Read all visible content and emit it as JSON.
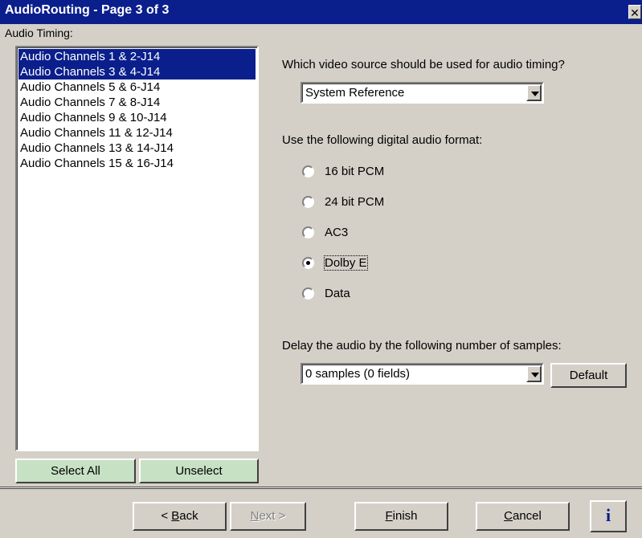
{
  "window": {
    "title": "AudioRouting - Page 3 of 3",
    "close_glyph": "✕"
  },
  "timing": {
    "label": "Audio Timing:",
    "channels": [
      {
        "label": "Audio Channels 1 & 2-J14",
        "selected": true
      },
      {
        "label": "Audio Channels 3 & 4-J14",
        "selected": true
      },
      {
        "label": "Audio Channels 5 & 6-J14",
        "selected": false
      },
      {
        "label": "Audio Channels 7 & 8-J14",
        "selected": false
      },
      {
        "label": "Audio Channels 9 & 10-J14",
        "selected": false
      },
      {
        "label": "Audio Channels 11 & 12-J14",
        "selected": false
      },
      {
        "label": "Audio Channels 13 & 14-J14",
        "selected": false
      },
      {
        "label": "Audio Channels 15 & 16-J14",
        "selected": false
      }
    ],
    "select_all": "Select All",
    "unselect": "Unselect"
  },
  "video_source": {
    "question": "Which video source should be used for audio timing?",
    "value": "System Reference"
  },
  "format": {
    "label": "Use the following digital audio format:",
    "options": [
      {
        "label": "16 bit PCM",
        "checked": false
      },
      {
        "label": "24 bit PCM",
        "checked": false
      },
      {
        "label": "AC3",
        "checked": false
      },
      {
        "label": "Dolby E",
        "checked": true
      },
      {
        "label": "Data",
        "checked": false
      }
    ]
  },
  "delay": {
    "label": "Delay the audio by the following number of samples:",
    "value": "0 samples (0 fields)",
    "default_button": "Default"
  },
  "footer": {
    "back": {
      "prefix": "< ",
      "accel": "B",
      "rest": "ack"
    },
    "next": {
      "accel": "N",
      "rest": "ext >"
    },
    "finish": {
      "accel": "F",
      "rest": "inish"
    },
    "cancel": {
      "accel": "C",
      "rest": "ancel"
    },
    "info": "i"
  },
  "colors": {
    "titlebar": "#0a1e8c",
    "selection": "#0a1e8c",
    "green_button": "#c7e1c4",
    "face": "#d4d0c8"
  }
}
